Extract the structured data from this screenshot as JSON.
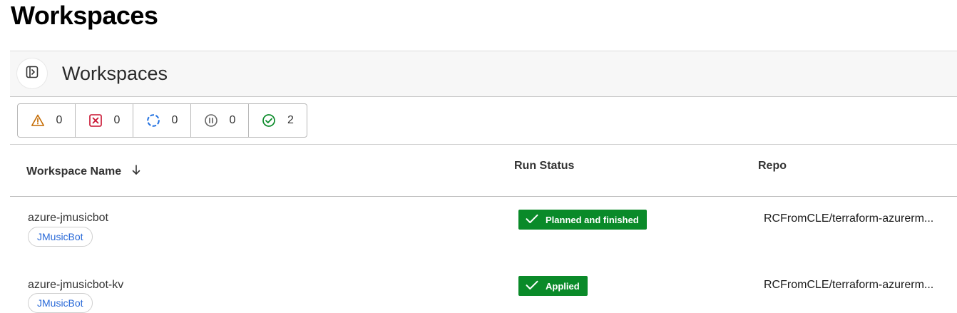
{
  "page": {
    "title": "Workspaces"
  },
  "panel": {
    "title": "Workspaces",
    "toggle_icon": "sidebar-expand-icon"
  },
  "filters": [
    {
      "icon": "warning-icon",
      "count": "0",
      "color": "#c46a00"
    },
    {
      "icon": "error-icon",
      "count": "0",
      "color": "#c8102e"
    },
    {
      "icon": "running-icon",
      "count": "0",
      "color": "#1f6fe0"
    },
    {
      "icon": "paused-icon",
      "count": "0",
      "color": "#666666"
    },
    {
      "icon": "success-icon",
      "count": "2",
      "color": "#0a8a29"
    }
  ],
  "table": {
    "columns": {
      "name": "Workspace Name",
      "status": "Run Status",
      "repo": "Repo"
    },
    "sort_icon": "arrow-down-icon",
    "rows": [
      {
        "name": "azure-jmusicbot",
        "tag": "JMusicBot",
        "status": "Planned and finished",
        "repo": "RCFromCLE/terraform-azurerm..."
      },
      {
        "name": "azure-jmusicbot-kv",
        "tag": "JMusicBot",
        "status": "Applied",
        "repo": "RCFromCLE/terraform-azurerm..."
      }
    ]
  },
  "colors": {
    "status_success": "#0a8a29",
    "tag_text": "#2a6ad8"
  }
}
